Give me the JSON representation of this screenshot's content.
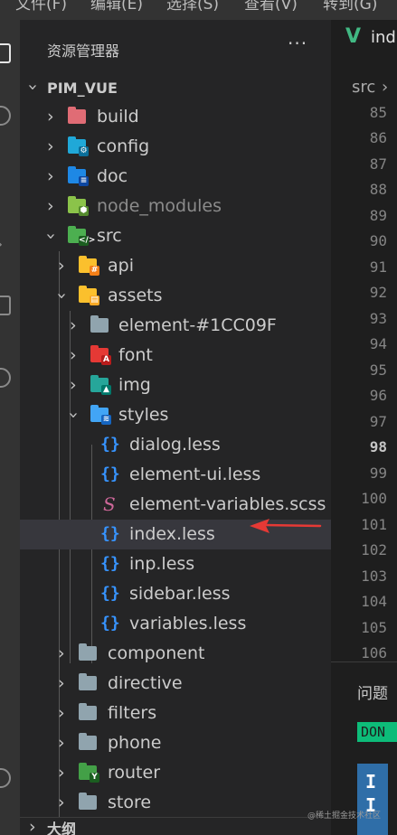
{
  "menu": [
    "文件(F)",
    "编辑(E)",
    "选择(S)",
    "查看(V)",
    "转到(G)"
  ],
  "sidebar": {
    "title": "资源管理器",
    "more": "···",
    "root": "PIM_VUE",
    "outline": "大纲"
  },
  "tree": [
    {
      "name": "build",
      "icon": "build-folder-icon",
      "color": "#e06c75"
    },
    {
      "name": "config",
      "icon": "config-folder-icon",
      "color": "#20a8d8"
    },
    {
      "name": "doc",
      "icon": "doc-folder-icon",
      "color": "#1e88e5"
    },
    {
      "name": "node_modules",
      "icon": "node-modules-folder-icon",
      "color": "#8bc34a"
    },
    {
      "name": "src",
      "icon": "src-folder-icon",
      "color": "#4caf50"
    },
    {
      "name": "api",
      "icon": "api-folder-icon",
      "color": "#fbc02d"
    },
    {
      "name": "assets",
      "icon": "assets-folder-icon",
      "color": "#fbc02d"
    },
    {
      "name": "element-#1CC09F",
      "icon": "folder-icon",
      "color": "#90a4ae"
    },
    {
      "name": "font",
      "icon": "font-folder-icon",
      "color": "#e53935"
    },
    {
      "name": "img",
      "icon": "img-folder-icon",
      "color": "#26a69a"
    },
    {
      "name": "styles",
      "icon": "styles-folder-icon",
      "color": "#42a5f5"
    },
    {
      "name": "dialog.less",
      "icon": "less-file-icon",
      "color": "#3794ff"
    },
    {
      "name": "element-ui.less",
      "icon": "less-file-icon",
      "color": "#3794ff"
    },
    {
      "name": "element-variables.scss",
      "icon": "sass-file-icon",
      "color": "#cd6799"
    },
    {
      "name": "index.less",
      "icon": "less-file-icon",
      "color": "#3794ff"
    },
    {
      "name": "inp.less",
      "icon": "less-file-icon",
      "color": "#3794ff"
    },
    {
      "name": "sidebar.less",
      "icon": "less-file-icon",
      "color": "#3794ff"
    },
    {
      "name": "variables.less",
      "icon": "less-file-icon",
      "color": "#3794ff"
    },
    {
      "name": "component",
      "icon": "folder-icon",
      "color": "#90a4ae"
    },
    {
      "name": "directive",
      "icon": "folder-icon",
      "color": "#90a4ae"
    },
    {
      "name": "filters",
      "icon": "folder-icon",
      "color": "#90a4ae"
    },
    {
      "name": "phone",
      "icon": "folder-icon",
      "color": "#90a4ae"
    },
    {
      "name": "router",
      "icon": "router-folder-icon",
      "color": "#43a047"
    },
    {
      "name": "store",
      "icon": "folder-icon",
      "color": "#90a4ae"
    }
  ],
  "selected_file": "index.less",
  "editor": {
    "tab_label": "ind",
    "breadcrumb": "src",
    "line_numbers": [
      "85",
      "86",
      "87",
      "88",
      "89",
      "90",
      "91",
      "92",
      "93",
      "94",
      "95",
      "96",
      "97",
      "98",
      "99",
      "100",
      "101",
      "102",
      "103",
      "104",
      "105",
      "106"
    ],
    "current_line": "98"
  },
  "panel": {
    "title": "问题",
    "badge": "DON",
    "block_chars": [
      "I",
      "I"
    ]
  },
  "watermark": "@稀土掘金技术社区",
  "colors": {
    "accent_arrow": "#e53935",
    "vue_green": "#41b883",
    "selection": "#37373d"
  }
}
